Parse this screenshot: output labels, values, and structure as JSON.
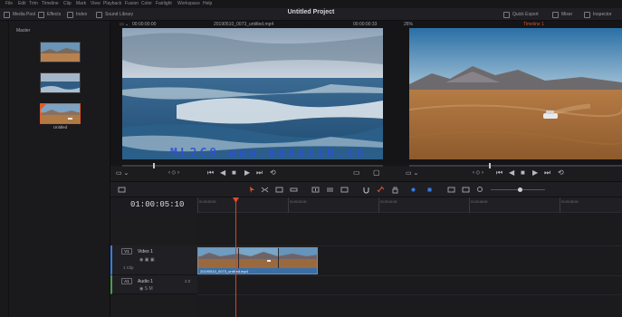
{
  "menu": [
    "File",
    "Edit",
    "Trim",
    "Timeline",
    "Clip",
    "Mark",
    "View",
    "Playback",
    "Fusion",
    "Color",
    "Fairlight",
    "Workspace",
    "Help"
  ],
  "toolbar": {
    "left_items": [
      "Media Pool",
      "Effects",
      "Index",
      "Sound Library"
    ],
    "project_title": "Untitled Project",
    "right_items": [
      "Quick Export",
      "Mixer",
      "Inspector"
    ]
  },
  "media_pool": {
    "header": "Master",
    "clips": [
      {
        "label": ""
      },
      {
        "label": ""
      },
      {
        "label": "Untitled"
      }
    ]
  },
  "source_viewer": {
    "left_timecode": "00:00:00:00",
    "clip_name": "20190510_0073_untitled.mp4",
    "right_timecode": "00:00:00:33"
  },
  "timeline_viewer": {
    "zoom": "26%",
    "timeline_name": "Timeline 1"
  },
  "timeline": {
    "timecode": "01:00:05:10",
    "ruler_labels": [
      "01:00:00:00",
      "01:00:02:00",
      "01:00:04:00",
      "01:00:06:00",
      "01:00:08:00"
    ],
    "tracks": {
      "video": {
        "id": "V1",
        "name": "Video 1",
        "sub": "1 Clip",
        "clip_name": "20190510_0073_untitled.mp4"
      },
      "audio": {
        "id": "A1",
        "name": "Audio 1",
        "level": "2.0"
      }
    }
  },
  "watermark": "ML2C8  www.aanxxib.cn",
  "colors": {
    "playhead": "#d8402a",
    "video_clip": "#3a6ea5",
    "selection": "#e05a2a",
    "watermark": "#2d4fd8"
  }
}
